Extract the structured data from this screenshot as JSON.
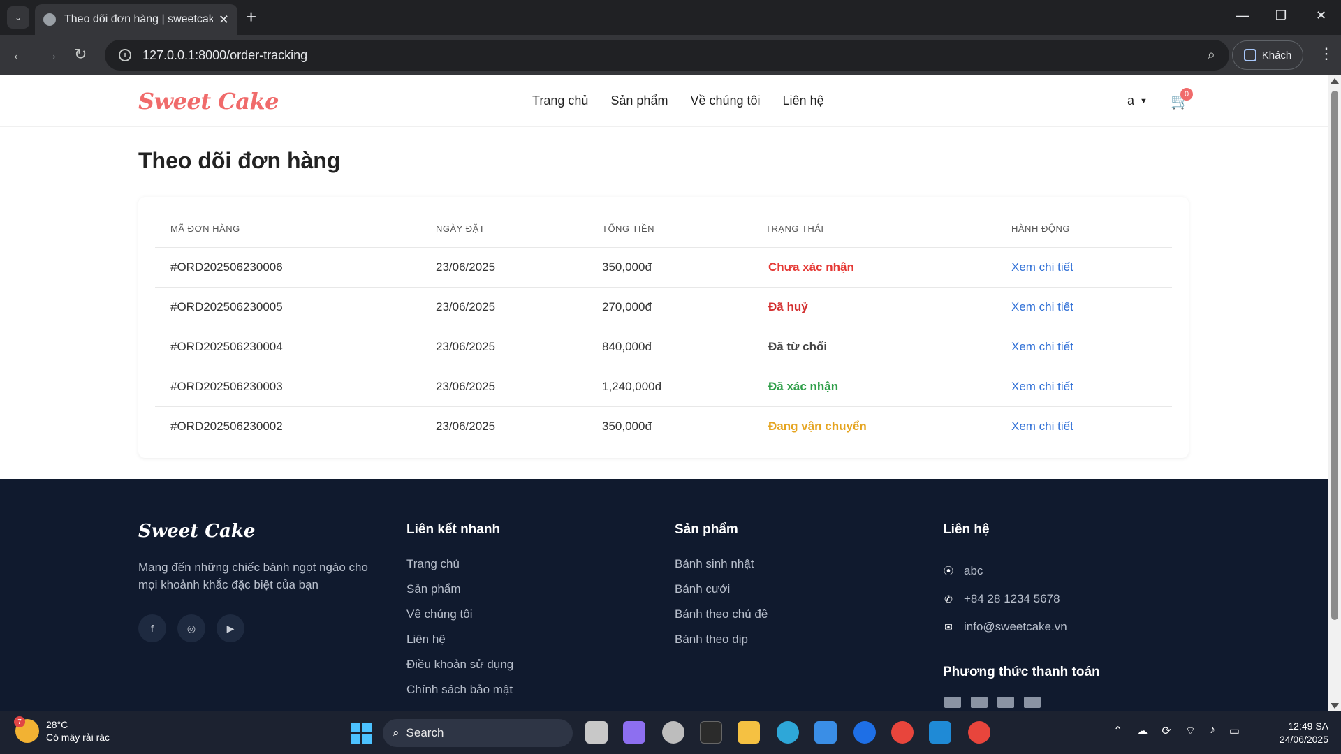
{
  "browser": {
    "tab_title": "Theo dõi đơn hàng | sweetcake",
    "url": "127.0.0.1:8000/order-tracking",
    "profile_label": "Khách"
  },
  "header": {
    "logo": "Sweet Cake",
    "nav": [
      "Trang chủ",
      "Sản phẩm",
      "Về chúng tôi",
      "Liên hệ"
    ],
    "user": "a",
    "cart_count": "0"
  },
  "page": {
    "title": "Theo dõi đơn hàng"
  },
  "orders": {
    "columns": [
      "MÃ ĐƠN HÀNG",
      "NGÀY ĐẶT",
      "TỔNG TIỀN",
      "TRẠNG THÁI",
      "HÀNH ĐỘNG"
    ],
    "rows": [
      {
        "id": "#ORD202506230006",
        "date": "23/06/2025",
        "total": "350,000đ",
        "status": "Chưa xác nhận",
        "status_color": "#e53935",
        "action": "Xem chi tiết"
      },
      {
        "id": "#ORD202506230005",
        "date": "23/06/2025",
        "total": "270,000đ",
        "status": "Đã huỷ",
        "status_color": "#d32f2f",
        "action": "Xem chi tiết"
      },
      {
        "id": "#ORD202506230004",
        "date": "23/06/2025",
        "total": "840,000đ",
        "status": "Đã từ chối",
        "status_color": "#444444",
        "action": "Xem chi tiết"
      },
      {
        "id": "#ORD202506230003",
        "date": "23/06/2025",
        "total": "1,240,000đ",
        "status": "Đã xác nhận",
        "status_color": "#2e9e48",
        "action": "Xem chi tiết"
      },
      {
        "id": "#ORD202506230002",
        "date": "23/06/2025",
        "total": "350,000đ",
        "status": "Đang vận chuyển",
        "status_color": "#e5a41f",
        "action": "Xem chi tiết"
      }
    ]
  },
  "footer": {
    "logo": "Sweet Cake",
    "description": "Mang đến những chiếc bánh ngọt ngào cho mọi khoảnh khắc đặc biệt của bạn",
    "quick_links_title": "Liên kết nhanh",
    "quick_links": [
      "Trang chủ",
      "Sản phẩm",
      "Về chúng tôi",
      "Liên hệ",
      "Điều khoản sử dụng",
      "Chính sách bảo mật"
    ],
    "products_title": "Sản phẩm",
    "products": [
      "Bánh sinh nhật",
      "Bánh cưới",
      "Bánh theo chủ đề",
      "Bánh theo dịp"
    ],
    "contact_title": "Liên hệ",
    "contact": {
      "address": "abc",
      "phone": "+84 28 1234 5678",
      "email": "info@sweetcake.vn"
    },
    "payment_title": "Phương thức thanh toán"
  },
  "taskbar": {
    "weather_temp": "28°C",
    "weather_desc": "Có mây rải rác",
    "weather_badge": "7",
    "search_label": "Search",
    "time": "12:49 SA",
    "date": "24/06/2025"
  }
}
